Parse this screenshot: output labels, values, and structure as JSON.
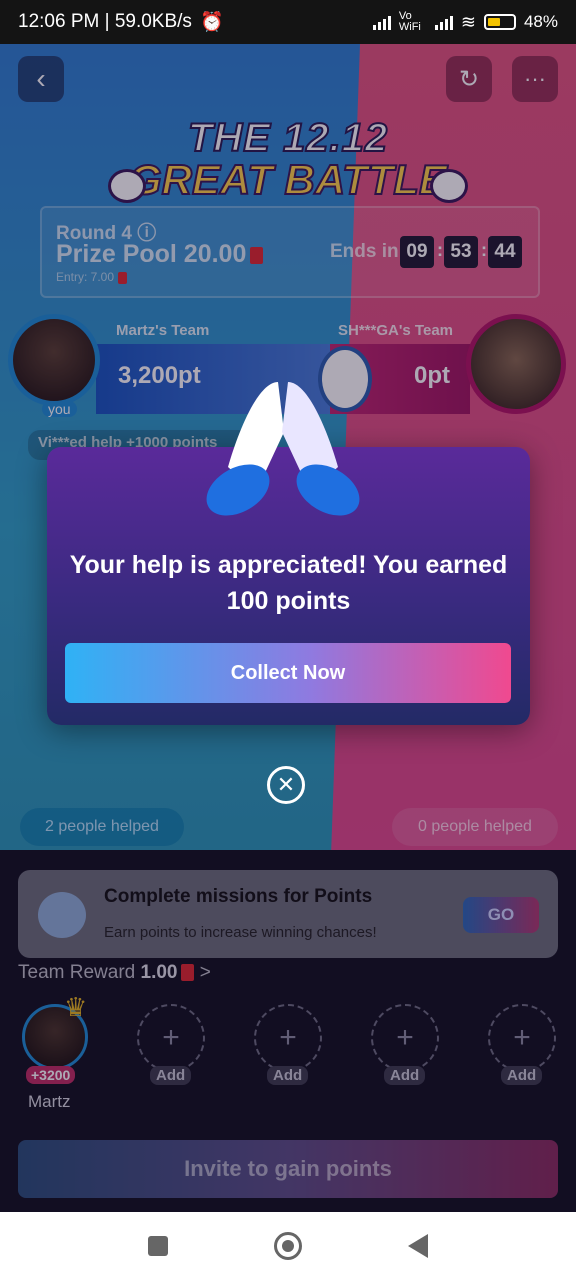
{
  "status_bar": {
    "time_speed": "12:06 PM | 59.0KB/s",
    "network": "Vo WiFi",
    "battery": "48%"
  },
  "header": {
    "title_line1": "THE 12.12",
    "title_line2": "GREAT BATTLE"
  },
  "round": {
    "label": "Round 4",
    "prize_pool": "Prize Pool 20.00",
    "entry": "Entry: 7.00",
    "ends_label": "Ends in",
    "time": [
      "09",
      "53",
      "44"
    ]
  },
  "teams": {
    "left": {
      "name": "Martz's Team",
      "points": "3,200pt",
      "you_label": "you"
    },
    "right": {
      "name": "SH***GA's Team",
      "points": "0pt"
    }
  },
  "ticker": "Vi***ed help +1000 points",
  "helped": {
    "left": "2 people helped",
    "right": "0 people helped"
  },
  "modal": {
    "message": "Your help is appreciated! You earned 100 points",
    "collect_label": "Collect Now",
    "close_icon": "close-icon"
  },
  "mission": {
    "title": "Complete missions for Points",
    "subtitle": "Earn points to increase winning chances!",
    "go_label": "GO"
  },
  "team_reward": {
    "label": "Team Reward",
    "value": "1.00",
    "chevron": ">"
  },
  "members": {
    "first": {
      "points": "+3200",
      "name": "Martz"
    },
    "add_label": "Add"
  },
  "invite_label": "Invite to gain points"
}
